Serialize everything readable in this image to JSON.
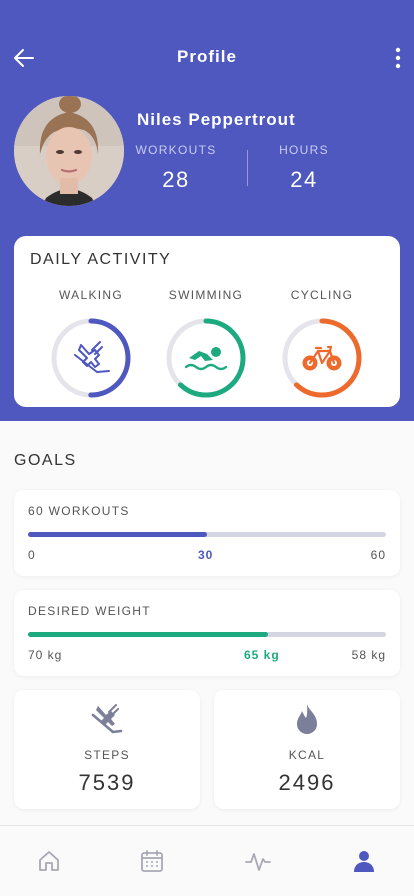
{
  "header": {
    "title": "Profile",
    "accent": "#4e58bf"
  },
  "profile": {
    "name": "Niles Peppertrout",
    "stats": [
      {
        "label": "WORKOUTS",
        "value": "28"
      },
      {
        "label": "HOURS",
        "value": "24"
      }
    ]
  },
  "daily_activity": {
    "title": "DAILY ACTIVITY",
    "items": [
      {
        "label": "WALKING",
        "icon": "walking-shoe-icon",
        "color": "#4e58bf",
        "progress": 0.5
      },
      {
        "label": "SWIMMING",
        "icon": "swimmer-icon",
        "color": "#1daa80",
        "progress": 0.62
      },
      {
        "label": "CYCLING",
        "icon": "bicycle-icon",
        "color": "#ee6a2c",
        "progress": 0.62
      }
    ]
  },
  "goals": {
    "title": "GOALS",
    "workouts": {
      "label": "60 WORKOUTS",
      "min": "0",
      "current": "30",
      "max": "60",
      "progress": 0.5,
      "color": "#4e58bf"
    },
    "weight": {
      "label": "DESIRED WEIGHT",
      "min": "70 kg",
      "current": "65 kg",
      "max": "58 kg",
      "progress": 0.67,
      "color": "#1daa80"
    }
  },
  "summary": [
    {
      "label": "STEPS",
      "value": "7539",
      "icon": "shoe-icon"
    },
    {
      "label": "KCAL",
      "value": "2496",
      "icon": "flame-icon"
    }
  ],
  "tabs": [
    {
      "name": "home",
      "icon": "home-icon"
    },
    {
      "name": "calendar",
      "icon": "calendar-icon"
    },
    {
      "name": "activity",
      "icon": "activity-icon"
    },
    {
      "name": "profile",
      "icon": "user-icon",
      "active": true
    }
  ]
}
